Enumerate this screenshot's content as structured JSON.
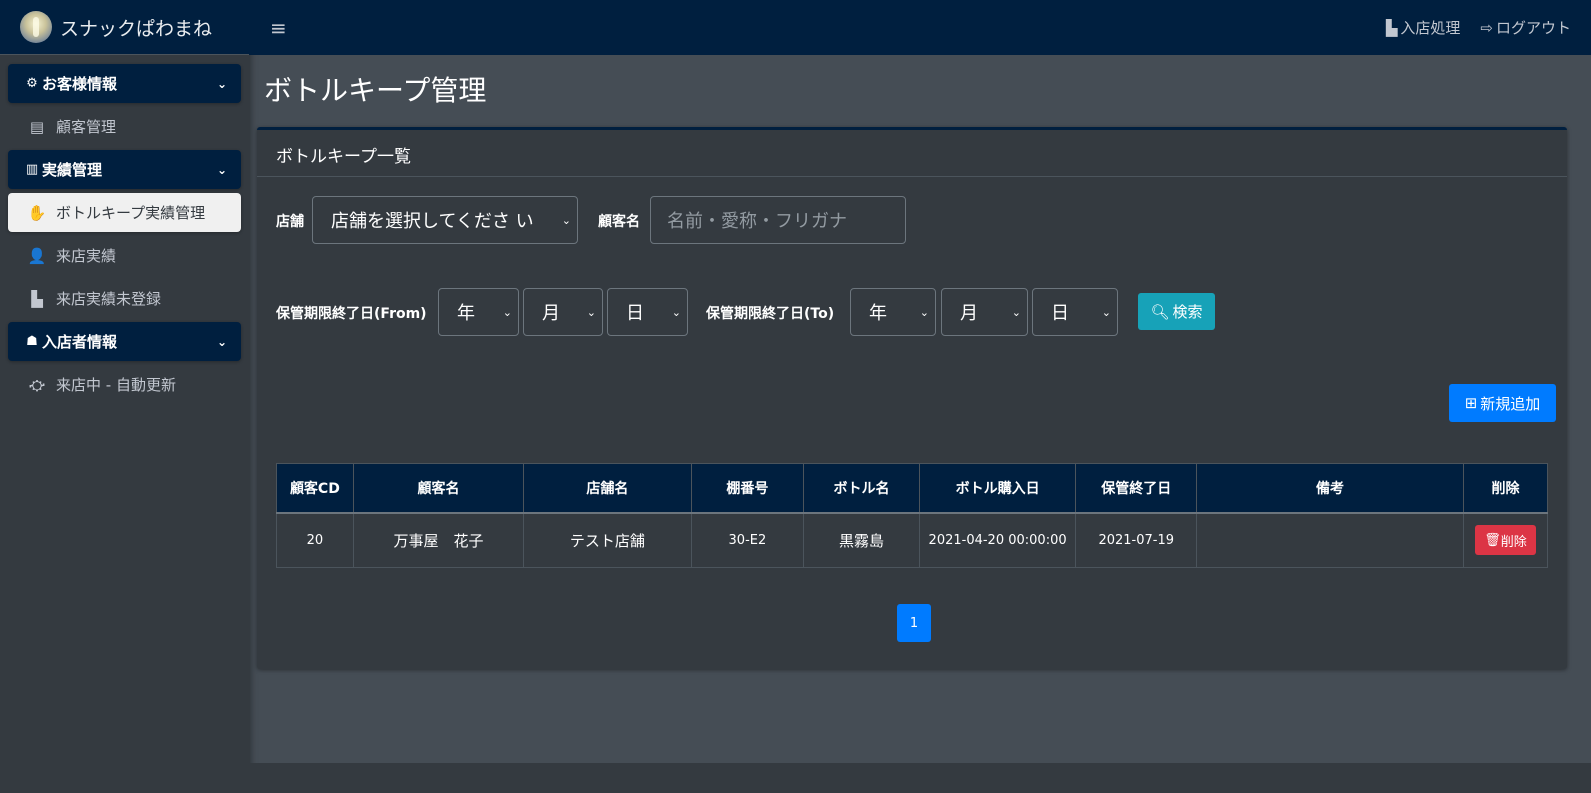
{
  "brand": {
    "name": "スナックぱわまね"
  },
  "sidebar": {
    "sections": [
      {
        "label": "お客様情報",
        "icon": "gear-icon",
        "items": [
          {
            "label": "顧客管理",
            "icon": "id-card-icon"
          }
        ]
      },
      {
        "label": "実績管理",
        "icon": "bar-chart-icon",
        "items": [
          {
            "label": "ボトルキープ実績管理",
            "icon": "hand-paper-icon",
            "active": true
          },
          {
            "label": "来店実績",
            "icon": "user-clock-icon"
          },
          {
            "label": "来店実績未登録",
            "icon": "door-open-icon"
          }
        ]
      },
      {
        "label": "入店者情報",
        "icon": "users-icon",
        "items": [
          {
            "label": "来店中 - 自動更新",
            "icon": "binoculars-icon"
          }
        ]
      }
    ]
  },
  "topbar": {
    "checkin_label": "入店処理",
    "logout_label": "ログアウト"
  },
  "page": {
    "title": "ボトルキープ管理"
  },
  "card": {
    "title": "ボトルキープ一覧"
  },
  "filters": {
    "store_label": "店舗",
    "store_value": "店舗を選択してくださ い",
    "customer_label": "顧客名",
    "customer_placeholder": "名前・愛称・フリガナ",
    "from_label": "保管期限終了日(From)",
    "to_label": "保管期限終了日(To)",
    "year": "年",
    "month": "月",
    "day": "日",
    "search_label": "検索"
  },
  "actions": {
    "add_label": "新規追加"
  },
  "table": {
    "headers": [
      "顧客CD",
      "顧客名",
      "店舗名",
      "棚番号",
      "ボトル名",
      "ボトル購入日",
      "保管終了日",
      "備考",
      "削除"
    ],
    "rows": [
      {
        "cd": "20",
        "name": "万事屋　花子",
        "store": "テスト店舗",
        "shelf": "30-E2",
        "bottle": "黒霧島",
        "purchase": "2021-04-20 00:00:00",
        "end": "2021-07-19",
        "note": "",
        "delete_label": "削除"
      }
    ]
  },
  "pagination": {
    "current": "1"
  },
  "colors": {
    "navy": "#001f3f",
    "info": "#17a2b8",
    "primary": "#007bff",
    "danger": "#dc3545"
  }
}
